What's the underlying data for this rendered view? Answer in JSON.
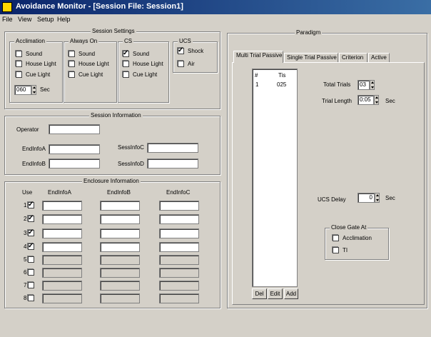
{
  "window": {
    "title": "Avoidance Monitor - [Session File: Session1]"
  },
  "menu": [
    "File",
    "View",
    "Setup",
    "Help"
  ],
  "session_settings": {
    "title": "Session Settings",
    "acclimation": {
      "title": "Acclimation",
      "sound": "Sound",
      "house_light": "House Light",
      "cue_light": "Cue Light",
      "seconds_value": "060",
      "sec_label": "Sec"
    },
    "always_on": {
      "title": "Always On",
      "sound": "Sound",
      "house_light": "House Light",
      "cue_light": "Cue Light"
    },
    "cs": {
      "title": "CS",
      "sound": "Sound",
      "house_light": "House Light",
      "cue_light": "Cue Light"
    },
    "ucs": {
      "title": "UCS",
      "shock": "Shock",
      "air": "Air"
    }
  },
  "session_information": {
    "title": "Session Information",
    "operator": "Operator",
    "endinfo_a": "EndInfoA",
    "endinfo_b": "EndInfoB",
    "sessinfo_c": "SessInfoC",
    "sessinfo_d": "SessInfoD"
  },
  "enclosure_information": {
    "title": "Enclosure Information",
    "use": "Use",
    "col_a": "EndInfoA",
    "col_b": "EndInfoB",
    "col_c": "EndInfoC",
    "rows": [
      "1",
      "2",
      "3",
      "4",
      "5",
      "6",
      "7",
      "8"
    ]
  },
  "paradigm": {
    "title": "Paradigm",
    "tabs": [
      "Multi Trial Passive",
      "Single Trial Passive",
      "Criterion",
      "Active"
    ],
    "list_headers": [
      "#",
      "Tis"
    ],
    "list_rows": [
      [
        "1",
        "025"
      ]
    ],
    "total_trials_label": "Total Trials",
    "total_trials_value": "03",
    "trial_length_label": "Trial Length",
    "trial_length_value": "0:05",
    "sec_label": "Sec",
    "ucs_delay_label": "UCS Delay",
    "ucs_delay_value": "0",
    "close_gate_title": "Close Gate At",
    "acclimation": "Acclimation",
    "ti": "TI",
    "buttons": [
      "Del",
      "Edit",
      "Add"
    ]
  }
}
